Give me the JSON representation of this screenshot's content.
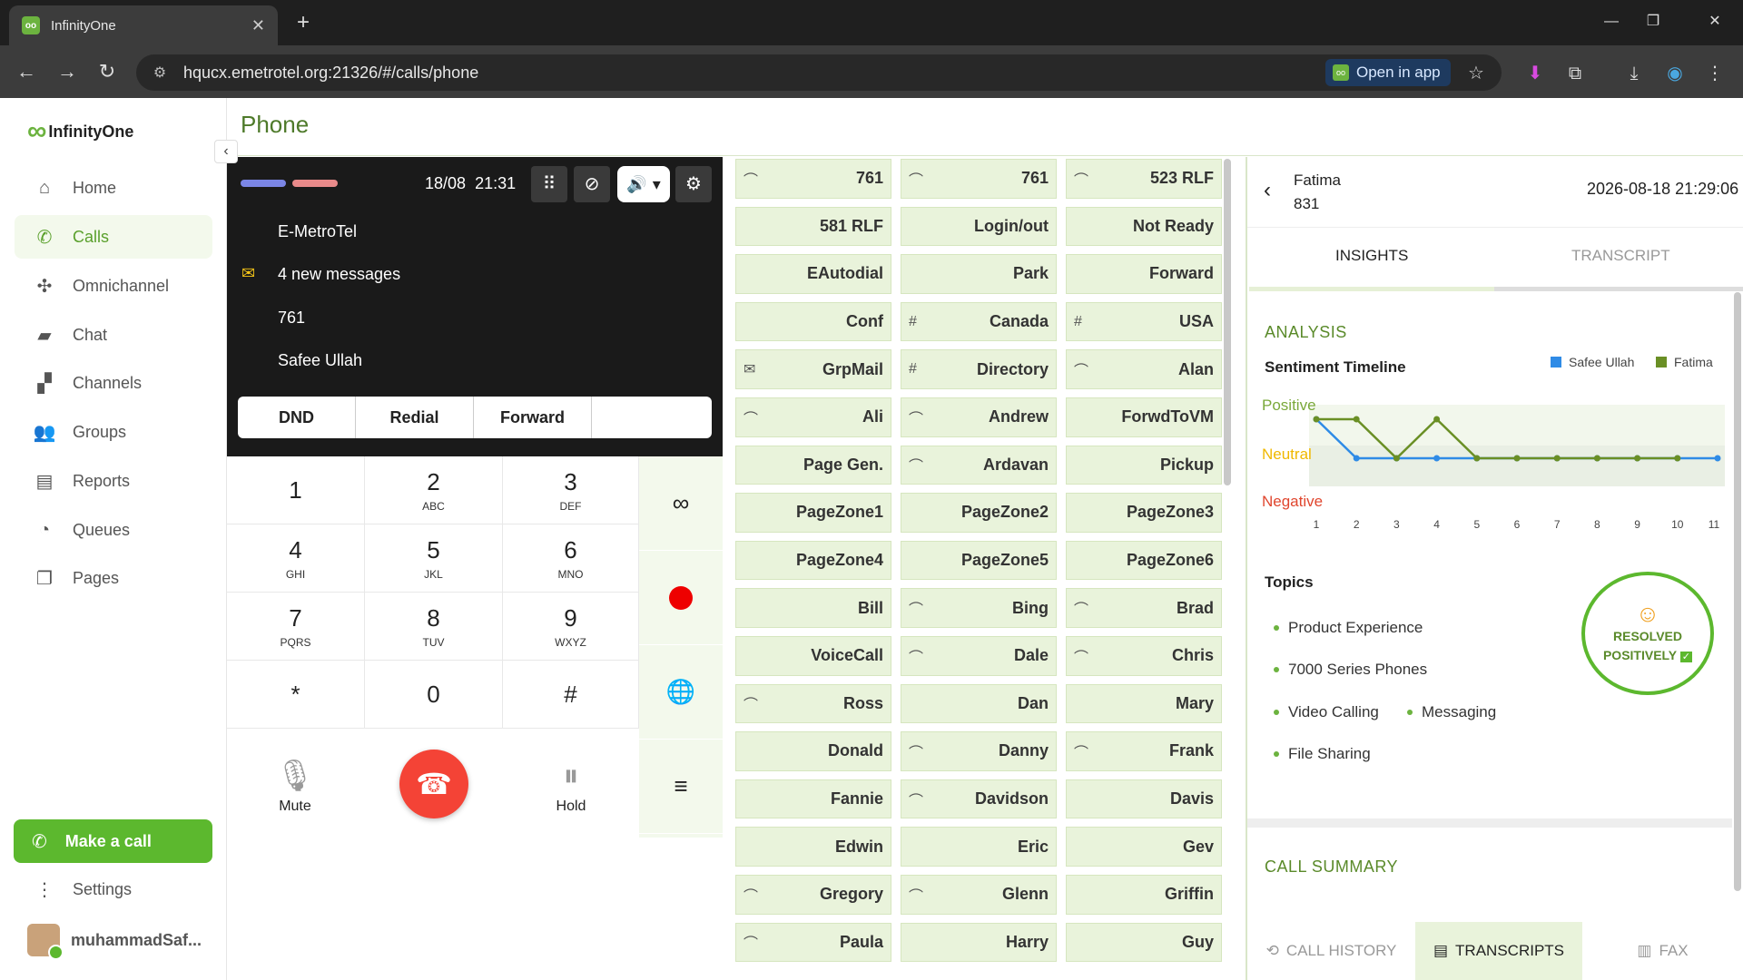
{
  "browser": {
    "tab_title": "InfinityOne",
    "favicon": "oo",
    "url": "hqucx.emetrotel.org:21326/#/calls/phone",
    "open_in_app": "Open in app",
    "new_tab": "+",
    "tab_close": "✕"
  },
  "app": {
    "logo_mark": "∞",
    "logo_text": "InfinityOne",
    "page_title": "Phone",
    "nav": [
      {
        "label": "Home",
        "icon": "home-icon",
        "glyph": "⌂"
      },
      {
        "label": "Calls",
        "icon": "phone-icon",
        "glyph": "✆"
      },
      {
        "label": "Omnichannel",
        "icon": "omnichannel-icon",
        "glyph": "✣"
      },
      {
        "label": "Chat",
        "icon": "chat-icon",
        "glyph": "▰"
      },
      {
        "label": "Channels",
        "icon": "channels-icon",
        "glyph": "▞"
      },
      {
        "label": "Groups",
        "icon": "groups-icon",
        "glyph": "👥"
      },
      {
        "label": "Reports",
        "icon": "reports-icon",
        "glyph": "▤"
      },
      {
        "label": "Queues",
        "icon": "queues-icon",
        "glyph": "◔"
      },
      {
        "label": "Pages",
        "icon": "pages-icon",
        "glyph": "❐"
      }
    ],
    "make_call": "Make a call",
    "settings": "Settings",
    "user": "muhammadSaf...",
    "active_color": "#5cb82e"
  },
  "phone": {
    "date": "18/08",
    "time": "21:31",
    "status_lines": [
      "E-MetroTel",
      "4 new messages",
      "761",
      "Safee Ullah"
    ],
    "quick_buttons": [
      "DND",
      "Redial",
      "Forward",
      ""
    ],
    "keys": [
      {
        "d": "1",
        "l": ""
      },
      {
        "d": "2",
        "l": "ABC"
      },
      {
        "d": "3",
        "l": "DEF"
      },
      {
        "d": "4",
        "l": "GHI"
      },
      {
        "d": "5",
        "l": "JKL"
      },
      {
        "d": "6",
        "l": "MNO"
      },
      {
        "d": "7",
        "l": "PQRS"
      },
      {
        "d": "8",
        "l": "TUV"
      },
      {
        "d": "9",
        "l": "WXYZ"
      },
      {
        "d": "*",
        "l": ""
      },
      {
        "d": "0",
        "l": ""
      },
      {
        "d": "#",
        "l": ""
      }
    ],
    "mute_label": "Mute",
    "hold_label": "Hold"
  },
  "speed_dials": [
    {
      "label": "761",
      "icon": "line-icon"
    },
    {
      "label": "761",
      "icon": "line-icon"
    },
    {
      "label": "523 RLF",
      "icon": "line-icon"
    },
    {
      "label": "581 RLF",
      "icon": ""
    },
    {
      "label": "Login/out",
      "icon": ""
    },
    {
      "label": "Not Ready",
      "icon": ""
    },
    {
      "label": "EAutodial",
      "icon": ""
    },
    {
      "label": "Park",
      "icon": ""
    },
    {
      "label": "Forward",
      "icon": ""
    },
    {
      "label": "Conf",
      "icon": ""
    },
    {
      "label": "Canada",
      "icon": "hash-icon"
    },
    {
      "label": "USA",
      "icon": "hash-icon"
    },
    {
      "label": "GrpMail",
      "icon": "mail-icon"
    },
    {
      "label": "Directory",
      "icon": "hash-icon"
    },
    {
      "label": "Alan",
      "icon": "line-icon"
    },
    {
      "label": "Ali",
      "icon": "line-icon"
    },
    {
      "label": "Andrew",
      "icon": "line-icon"
    },
    {
      "label": "ForwdToVM",
      "icon": ""
    },
    {
      "label": "Page Gen.",
      "icon": ""
    },
    {
      "label": "Ardavan",
      "icon": "line-icon"
    },
    {
      "label": "Pickup",
      "icon": ""
    },
    {
      "label": "PageZone1",
      "icon": ""
    },
    {
      "label": "PageZone2",
      "icon": ""
    },
    {
      "label": "PageZone3",
      "icon": ""
    },
    {
      "label": "PageZone4",
      "icon": ""
    },
    {
      "label": "PageZone5",
      "icon": ""
    },
    {
      "label": "PageZone6",
      "icon": ""
    },
    {
      "label": "Bill",
      "icon": ""
    },
    {
      "label": "Bing",
      "icon": "line-icon"
    },
    {
      "label": "Brad",
      "icon": "line-icon"
    },
    {
      "label": "VoiceCall",
      "icon": ""
    },
    {
      "label": "Dale",
      "icon": "line-icon"
    },
    {
      "label": "Chris",
      "icon": "line-icon"
    },
    {
      "label": "Ross",
      "icon": "line-icon"
    },
    {
      "label": "Dan",
      "icon": ""
    },
    {
      "label": "Mary",
      "icon": ""
    },
    {
      "label": "Donald",
      "icon": ""
    },
    {
      "label": "Danny",
      "icon": "line-icon"
    },
    {
      "label": "Frank",
      "icon": "line-icon"
    },
    {
      "label": "Fannie",
      "icon": ""
    },
    {
      "label": "Davidson",
      "icon": "line-icon"
    },
    {
      "label": "Davis",
      "icon": ""
    },
    {
      "label": "Edwin",
      "icon": ""
    },
    {
      "label": "Eric",
      "icon": ""
    },
    {
      "label": "Gev",
      "icon": ""
    },
    {
      "label": "Gregory",
      "icon": "line-icon"
    },
    {
      "label": "Glenn",
      "icon": "line-icon"
    },
    {
      "label": "Griffin",
      "icon": ""
    },
    {
      "label": "Paula",
      "icon": "line-icon"
    },
    {
      "label": "Harry",
      "icon": ""
    },
    {
      "label": "Guy",
      "icon": ""
    }
  ],
  "insights": {
    "caller_name": "Fatima",
    "caller_ext": "831",
    "timestamp": "2026-08-18 21:29:06",
    "tabs": [
      "INSIGHTS",
      "TRANSCRIPT"
    ],
    "analysis": "ANALYSIS",
    "sentiment_title": "Sentiment Timeline",
    "topics_title": "Topics",
    "topics": [
      "Product Experience",
      "7000 Series Phones",
      "Video Calling",
      "Messaging",
      "File Sharing"
    ],
    "resolved_line1": "RESOLVED",
    "resolved_line2": "POSITIVELY",
    "resolved_emoji": "☺",
    "call_summary": "CALL SUMMARY",
    "bottom_tabs": [
      "CALL HISTORY",
      "TRANSCRIPTS",
      "FAX"
    ]
  },
  "chart_data": {
    "type": "line",
    "title": "Sentiment Timeline",
    "x": [
      1,
      2,
      3,
      4,
      5,
      6,
      7,
      8,
      9,
      10,
      11
    ],
    "y_categories": [
      "Negative",
      "Neutral",
      "Positive"
    ],
    "y_category_colors": [
      "#e0462e",
      "#f0b800",
      "#7aa83a"
    ],
    "legend_position": "top-right",
    "series": [
      {
        "name": "Safee Ullah",
        "color": "#2f8be6",
        "values": [
          1,
          0,
          0,
          0,
          0,
          0,
          0,
          0,
          0,
          0,
          0
        ]
      },
      {
        "name": "Fatima",
        "color": "#6a8f25",
        "values": [
          1,
          1,
          0,
          1,
          0,
          0,
          0,
          0,
          0,
          0,
          null
        ]
      }
    ]
  }
}
